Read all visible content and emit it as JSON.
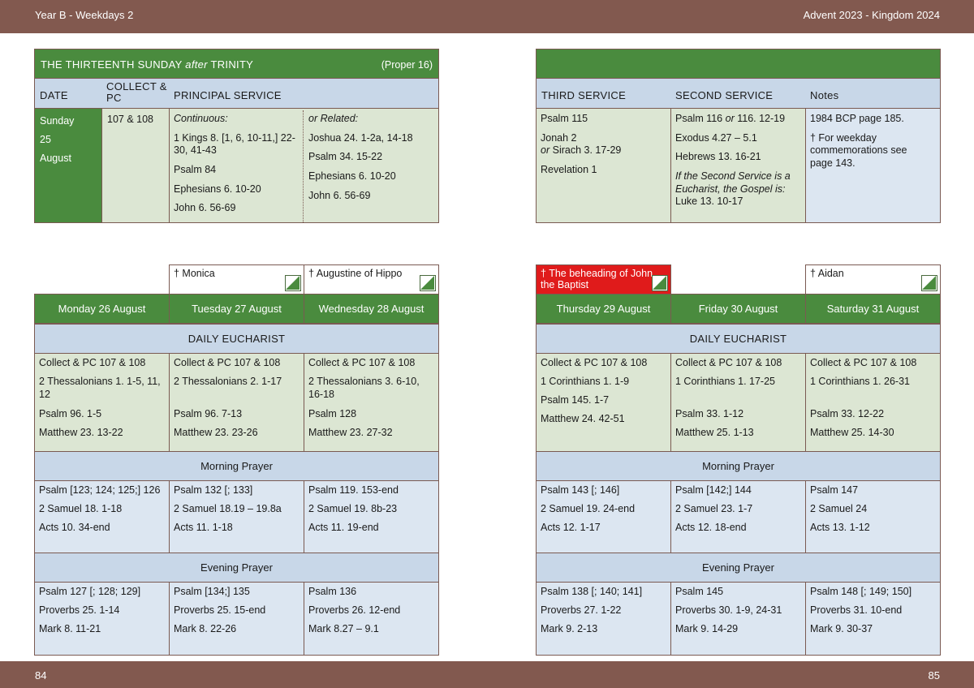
{
  "header": {
    "left": "Year B - Weekdays 2",
    "right": "Advent  2023 - Kingdom 2024"
  },
  "footer": {
    "left_page": "84",
    "right_page": "85"
  },
  "sunday": {
    "title_main": "THE THIRTEENTH SUNDAY",
    "title_after": "after",
    "title_trinity": "TRINITY",
    "proper": "(Proper 16)",
    "col_date": "DATE",
    "col_collect": "COLLECT & PC",
    "col_principal": "PRINCIPAL SERVICE",
    "col_third": "THIRD SERVICE",
    "col_second": "SECOND SERVICE",
    "col_notes": "Notes",
    "date": [
      "Sunday",
      "25",
      "August"
    ],
    "collect": "107 & 108",
    "continuous_label": "Continuous:",
    "continuous": [
      "1 Kings 8. [1, 6, 10-11,] 22-30, 41-43",
      "Psalm 84",
      "Ephesians 6. 10-20",
      "John 6. 56-69"
    ],
    "related_label": "or Related:",
    "related": [
      "Joshua 24. 1-2a, 14-18",
      "Psalm 34. 15-22",
      "Ephesians 6. 10-20",
      "John 6. 56-69"
    ],
    "third": {
      "psalm": "Psalm 115",
      "ot1": "Jonah 2",
      "ot_or": "or",
      "ot2": "Sirach 3. 17-29",
      "nt": "Revelation 1"
    },
    "second": {
      "psalm_a": "Psalm 116",
      "psalm_or": "or",
      "psalm_b": "116. 12-19",
      "ot": "Exodus 4.27 – 5.1",
      "nt": "Hebrews 13. 16-21",
      "note": "If the Second Service is a Eucharist, the Gospel is:",
      "gospel": "Luke 13. 10-17"
    },
    "notes": [
      "1984 BCP page 185.",
      "† For weekday commemorations see page 143."
    ]
  },
  "week": {
    "daily_eucharist": "DAILY EUCHARIST",
    "morning_prayer": "Morning Prayer",
    "evening_prayer": "Evening Prayer",
    "days": [
      {
        "name": "Monday 26 August",
        "commem": "",
        "eucharist": [
          "Collect & PC 107 & 108",
          "2 Thessalonians 1. 1-5, 11, 12",
          "Psalm 96. 1-5",
          "Matthew 23. 13-22"
        ],
        "morning": [
          "Psalm [123; 124; 125;] 126",
          "2 Samuel 18. 1-18",
          "Acts 10. 34-end"
        ],
        "evening": [
          "Psalm 127 [; 128; 129]",
          "Proverbs 25. 1-14",
          "Mark 8. 11-21"
        ]
      },
      {
        "name": "Tuesday 27 August",
        "commem": "† Monica",
        "eucharist": [
          "Collect & PC 107 & 108",
          "2 Thessalonians 2. 1-17",
          "Psalm 96. 7-13",
          "Matthew 23. 23-26"
        ],
        "morning": [
          "Psalm 132 [; 133]",
          "2 Samuel 18.19 – 19.8a",
          "Acts 11. 1-18"
        ],
        "evening": [
          "Psalm [134;] 135",
          "Proverbs 25. 15-end",
          "Mark 8. 22-26"
        ]
      },
      {
        "name": "Wednesday 28 August",
        "commem": "† Augustine of Hippo",
        "eucharist": [
          "Collect & PC 107 & 108",
          "2 Thessalonians 3. 6-10, 16-18",
          "Psalm 128",
          "Matthew 23. 27-32"
        ],
        "morning": [
          "Psalm 119. 153-end",
          "2 Samuel 19. 8b-23",
          "Acts 11. 19-end"
        ],
        "evening": [
          "Psalm 136",
          "Proverbs 26. 12-end",
          "Mark 8.27 – 9.1"
        ]
      },
      {
        "name": "Thursday 29 August",
        "commem": "† The beheading of John the Baptist",
        "eucharist": [
          "Collect & PC 107 & 108",
          "1 Corinthians 1. 1-9",
          "Psalm 145. 1-7",
          "Matthew 24. 42-51"
        ],
        "morning": [
          "Psalm 143 [; 146]",
          "2 Samuel 19. 24-end",
          "Acts 12. 1-17"
        ],
        "evening": [
          "Psalm 138 [; 140; 141]",
          "Proverbs 27. 1-22",
          "Mark 9. 2-13"
        ]
      },
      {
        "name": "Friday 30 August",
        "commem": "",
        "eucharist": [
          "Collect & PC 107 & 108",
          "1 Corinthians 1. 17-25",
          "Psalm 33. 1-12",
          "Matthew 25. 1-13"
        ],
        "morning": [
          "Psalm [142;] 144",
          "2 Samuel 23. 1-7",
          "Acts 12. 18-end"
        ],
        "evening": [
          "Psalm 145",
          "Proverbs 30. 1-9, 24-31",
          "Mark 9. 14-29"
        ]
      },
      {
        "name": "Saturday 31 August",
        "commem": "† Aidan",
        "eucharist": [
          "Collect & PC 107 & 108",
          "1 Corinthians 1. 26-31",
          "Psalm 33. 12-22",
          "Matthew 25. 14-30"
        ],
        "morning": [
          "Psalm 147",
          "2 Samuel 24",
          "Acts 13. 1-12"
        ],
        "evening": [
          "Psalm 148 [; 149; 150]",
          "Proverbs 31. 10-end",
          "Mark 9. 30-37"
        ]
      }
    ]
  },
  "colors": {
    "bar": "#82594f",
    "green": "#4a8b3e",
    "blue": "#c8d7e8",
    "sage": "#dce6d3",
    "lightblue": "#dce6f1",
    "red": "#e01b1b"
  }
}
